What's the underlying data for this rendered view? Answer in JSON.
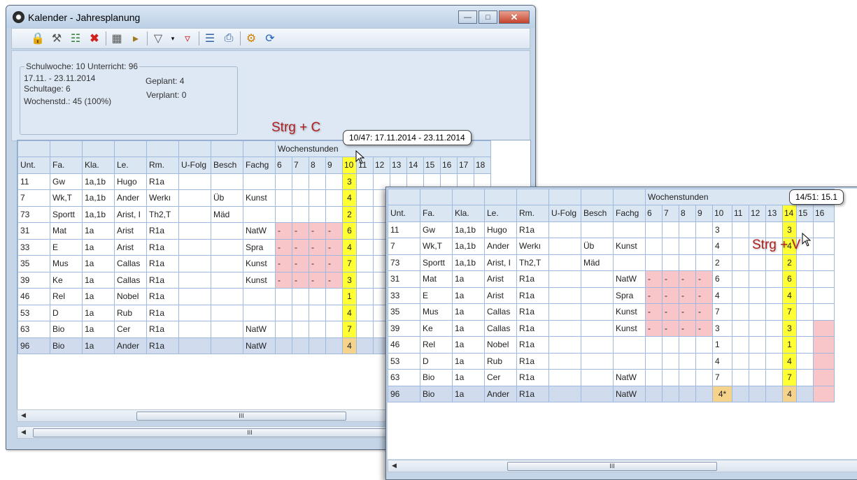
{
  "window1": {
    "title": "Kalender - Jahresplanung",
    "info": {
      "group_legend": "Schulwoche: 10  Unterricht: 96",
      "date_range": "17.11. - 23.11.2014",
      "schultage": "Schultage: 6",
      "wochenstd": "Wochenstd.: 45 (100%)",
      "geplant": "Geplant: 4",
      "verplant": "Verplant: 0"
    },
    "grid": {
      "group_header": "Wochenstunden",
      "headers": [
        "Unt.",
        "Fa.",
        "Kla.",
        "Le.",
        "Rm.",
        "U-Folg",
        "Besch",
        "Fachg",
        "6",
        "7",
        "8",
        "9",
        "10",
        "11",
        "12",
        "13",
        "14",
        "15",
        "16",
        "17",
        "18"
      ],
      "rows": [
        [
          "11",
          "Gw",
          "1a,1b",
          "Hugo",
          "R1a",
          "",
          "",
          "",
          "",
          "",
          "",
          "",
          "3"
        ],
        [
          "7",
          "Wk,T",
          "1a,1b",
          "Ander",
          "Werkı",
          "",
          "Üb",
          "Kunst",
          "",
          "",
          "",
          "",
          "4"
        ],
        [
          "73",
          "Sportt",
          "1a,1b",
          "Arist, I",
          "Th2,T",
          "",
          "Mäd",
          "",
          "",
          "",
          "",
          "",
          "2"
        ],
        [
          "31",
          "Mat",
          "1a",
          "Arist",
          "R1a",
          "",
          "",
          "NatW",
          "-",
          "-",
          "-",
          "-",
          "6"
        ],
        [
          "33",
          "E",
          "1a",
          "Arist",
          "R1a",
          "",
          "",
          "Spra",
          "-",
          "-",
          "-",
          "-",
          "4"
        ],
        [
          "35",
          "Mus",
          "1a",
          "Callas",
          "R1a",
          "",
          "",
          "Kunst",
          "-",
          "-",
          "-",
          "-",
          "7"
        ],
        [
          "39",
          "Ke",
          "1a",
          "Callas",
          "R1a",
          "",
          "",
          "Kunst",
          "-",
          "-",
          "-",
          "-",
          "3"
        ],
        [
          "46",
          "Rel",
          "1a",
          "Nobel",
          "R1a",
          "",
          "",
          "",
          "",
          "",
          "",
          "",
          "1"
        ],
        [
          "53",
          "D",
          "1a",
          "Rub",
          "R1a",
          "",
          "",
          "",
          "",
          "",
          "",
          "",
          "4"
        ],
        [
          "63",
          "Bio",
          "1a",
          "Cer",
          "R1a",
          "",
          "",
          "NatW",
          "",
          "",
          "",
          "",
          "7"
        ],
        [
          "96",
          "Bio",
          "1a",
          "Ander",
          "R1a",
          "",
          "",
          "NatW",
          "",
          "",
          "",
          "",
          "4"
        ]
      ],
      "scroll_label": "III"
    }
  },
  "window2": {
    "grid": {
      "group_header": "Wochenstunden",
      "headers": [
        "Unt.",
        "Fa.",
        "Kla.",
        "Le.",
        "Rm.",
        "U-Folg",
        "Besch",
        "Fachg",
        "6",
        "7",
        "8",
        "9",
        "10",
        "11",
        "12",
        "13",
        "14",
        "15",
        "16"
      ],
      "rows": [
        [
          "11",
          "Gw",
          "1a,1b",
          "Hugo",
          "R1a",
          "",
          "",
          "",
          "",
          "",
          "",
          "",
          "3",
          "",
          "",
          "",
          "3",
          ""
        ],
        [
          "7",
          "Wk,T",
          "1a,1b",
          "Ander",
          "Werkı",
          "",
          "Üb",
          "Kunst",
          "",
          "",
          "",
          "",
          "4",
          "",
          "",
          "",
          "4",
          ""
        ],
        [
          "73",
          "Sportt",
          "1a,1b",
          "Arist, I",
          "Th2,T",
          "",
          "Mäd",
          "",
          "",
          "",
          "",
          "",
          "2",
          "",
          "",
          "",
          "2",
          ""
        ],
        [
          "31",
          "Mat",
          "1a",
          "Arist",
          "R1a",
          "",
          "",
          "NatW",
          "-",
          "-",
          "-",
          "-",
          "6",
          "",
          "",
          "",
          "6",
          ""
        ],
        [
          "33",
          "E",
          "1a",
          "Arist",
          "R1a",
          "",
          "",
          "Spra",
          "-",
          "-",
          "-",
          "-",
          "4",
          "",
          "",
          "",
          "4",
          ""
        ],
        [
          "35",
          "Mus",
          "1a",
          "Callas",
          "R1a",
          "",
          "",
          "Kunst",
          "-",
          "-",
          "-",
          "-",
          "7",
          "",
          "",
          "",
          "7",
          ""
        ],
        [
          "39",
          "Ke",
          "1a",
          "Callas",
          "R1a",
          "",
          "",
          "Kunst",
          "-",
          "-",
          "-",
          "-",
          "3",
          "",
          "",
          "",
          "3",
          ""
        ],
        [
          "46",
          "Rel",
          "1a",
          "Nobel",
          "R1a",
          "",
          "",
          "",
          "",
          "",
          "",
          "",
          "1",
          "",
          "",
          "",
          "1",
          ""
        ],
        [
          "53",
          "D",
          "1a",
          "Rub",
          "R1a",
          "",
          "",
          "",
          "",
          "",
          "",
          "",
          "4",
          "",
          "",
          "",
          "4",
          ""
        ],
        [
          "63",
          "Bio",
          "1a",
          "Cer",
          "R1a",
          "",
          "",
          "NatW",
          "",
          "",
          "",
          "",
          "7",
          "",
          "",
          "",
          "7",
          ""
        ],
        [
          "96",
          "Bio",
          "1a",
          "Ander",
          "R1a",
          "",
          "",
          "NatW",
          "",
          "",
          "",
          "",
          "4*",
          "",
          "",
          "",
          "4",
          ""
        ]
      ],
      "scroll_label": "III"
    }
  },
  "annotations": {
    "copy": "Strg + C",
    "paste": "Strg + V",
    "tooltip1": "10/47: 17.11.2014 - 23.11.2014",
    "tooltip2": "14/51: 15.1"
  },
  "colors": {
    "planned": "#ffff33",
    "blocked": "#f8c5c8",
    "selected": "#f5d38a",
    "accent_red": "#b02020"
  }
}
